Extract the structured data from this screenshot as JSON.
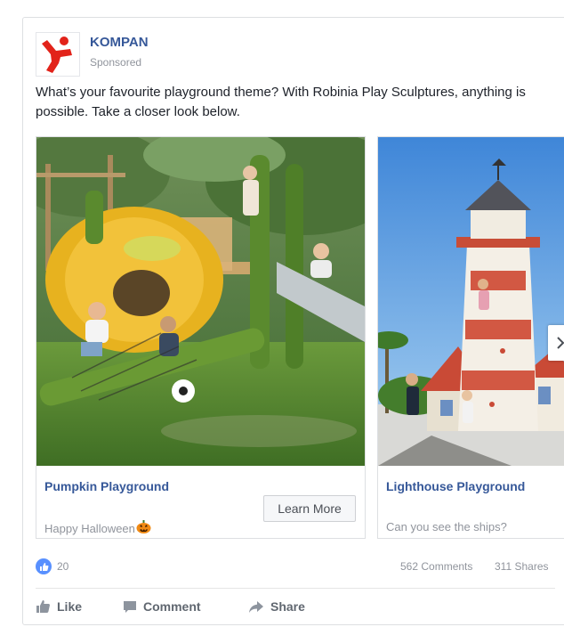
{
  "post": {
    "page_name": "KOMPAN",
    "sponsored_label": "Sponsored",
    "text": "What’s your favourite playground theme? With Robinia Play Sculptures, anything is possible. Take a closer look below."
  },
  "carousel": {
    "cards": [
      {
        "title": "Pumpkin Playground",
        "description": "Happy Halloween",
        "cta": "Learn More"
      },
      {
        "title": "Lighthouse Playground",
        "description": "Can you see the ships?"
      }
    ],
    "next_icon": "chevron-right-icon"
  },
  "stats": {
    "likes": "20",
    "comments": "562 Comments",
    "shares": "311 Shares"
  },
  "actions": {
    "like": "Like",
    "comment": "Comment",
    "share": "Share"
  },
  "colors": {
    "link": "#365899",
    "muted": "#90949c",
    "like_badge": "#5890ff",
    "logo_red": "#e2231a"
  }
}
